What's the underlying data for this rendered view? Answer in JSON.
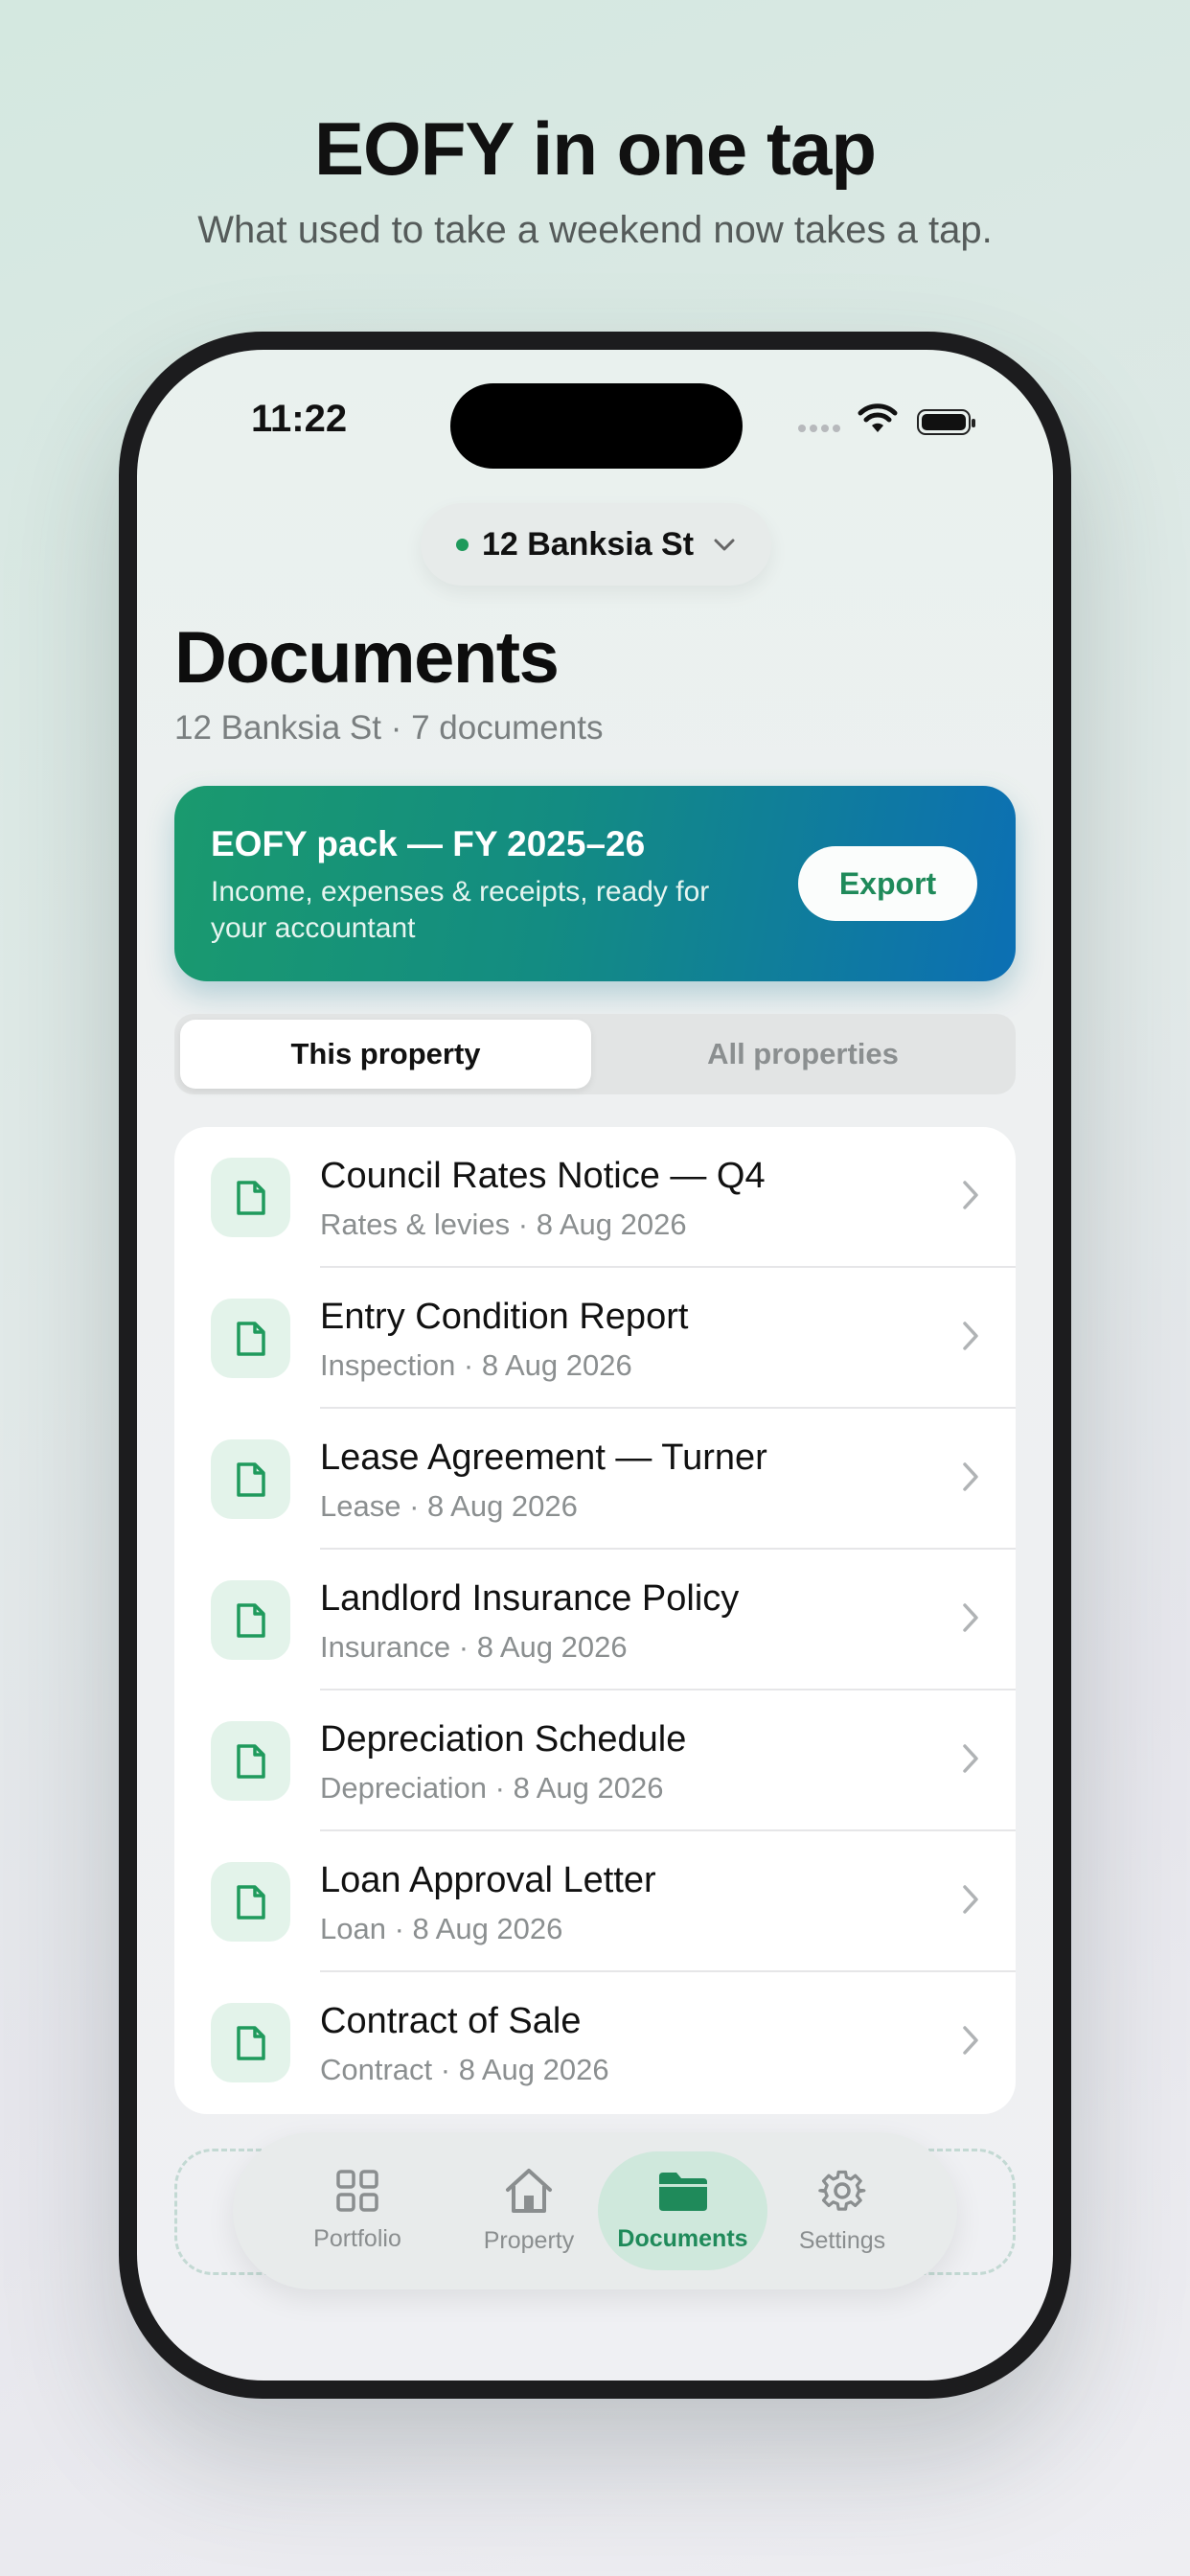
{
  "promo": {
    "headline": "EOFY in one tap",
    "subhead": "What used to take a weekend now takes a tap."
  },
  "status_bar": {
    "time": "11:22"
  },
  "property_selector": {
    "label": "12 Banksia St"
  },
  "header": {
    "title": "Documents",
    "subtitle": "12 Banksia St · 7 documents"
  },
  "eofy_card": {
    "title": "EOFY pack — FY 2025–26",
    "description": "Income, expenses & receipts, ready for your accountant",
    "export_label": "Export"
  },
  "segment": {
    "selected": "This property",
    "other": "All properties"
  },
  "documents": [
    {
      "title": "Council Rates Notice — Q4",
      "meta": "Rates & levies · 8 Aug 2026"
    },
    {
      "title": "Entry Condition Report",
      "meta": "Inspection · 8 Aug 2026"
    },
    {
      "title": "Lease Agreement — Turner",
      "meta": "Lease · 8 Aug 2026"
    },
    {
      "title": "Landlord Insurance Policy",
      "meta": "Insurance · 8 Aug 2026"
    },
    {
      "title": "Depreciation Schedule",
      "meta": "Depreciation · 8 Aug 2026"
    },
    {
      "title": "Loan Approval Letter",
      "meta": "Loan · 8 Aug 2026"
    },
    {
      "title": "Contract of Sale",
      "meta": "Contract · 8 Aug 2026"
    }
  ],
  "tabbar": {
    "items": [
      {
        "label": "Portfolio",
        "icon": "grid-icon"
      },
      {
        "label": "Property",
        "icon": "house-icon"
      },
      {
        "label": "Documents",
        "icon": "folder-icon"
      },
      {
        "label": "Settings",
        "icon": "gear-icon"
      }
    ],
    "active": "Documents"
  },
  "colors": {
    "accent": "#1f8a5a",
    "card_gradient_start": "#1a9a6e",
    "card_gradient_end": "#0c6fb4",
    "icon_tile": "#e3f3ea"
  }
}
